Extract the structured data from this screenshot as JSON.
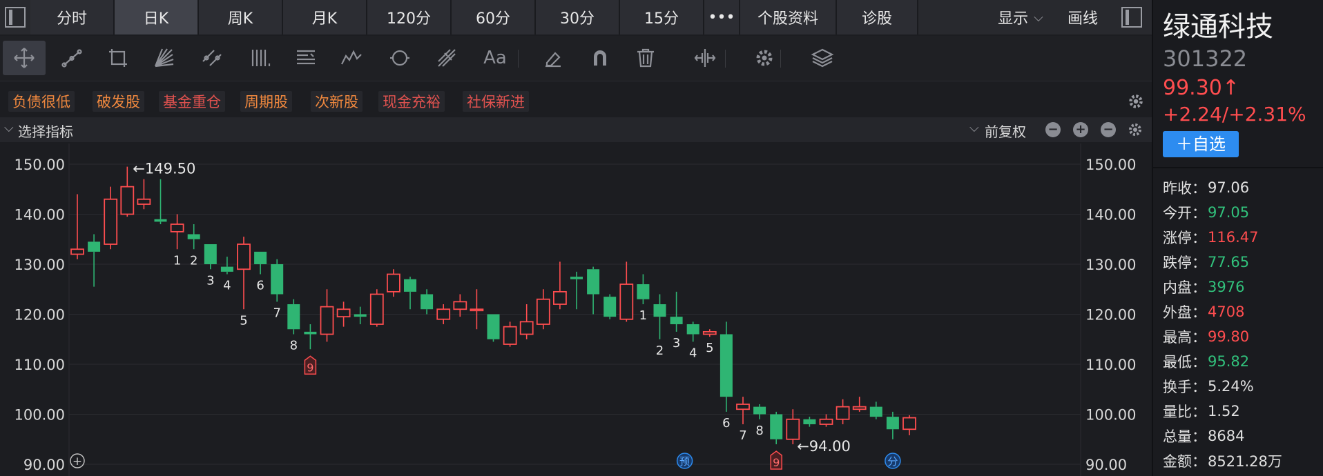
{
  "tabs": [
    {
      "label": "分时",
      "active": false
    },
    {
      "label": "日K",
      "active": true
    },
    {
      "label": "周K",
      "active": false
    },
    {
      "label": "月K",
      "active": false
    },
    {
      "label": "120分",
      "active": false
    },
    {
      "label": "60分",
      "active": false
    },
    {
      "label": "30分",
      "active": false
    },
    {
      "label": "15分",
      "active": false
    },
    {
      "label": "•••",
      "active": false
    },
    {
      "label": "个股资料",
      "active": false
    },
    {
      "label": "诊股",
      "active": false
    }
  ],
  "header_right": {
    "display_label": "显示",
    "draw_label": "画线"
  },
  "tools": [
    "move-tool-icon",
    "line-segment-icon",
    "rectangle-icon",
    "fan-icon",
    "parallel-channel-icon",
    "vertical-lines-icon",
    "gann-icon",
    "wave-icon",
    "cycle-icon",
    "fork-icon",
    "text-icon",
    "eraser-icon",
    "magnet-icon",
    "trash-icon",
    "scale-icon",
    "settings-icon",
    "layers-icon"
  ],
  "text_tool_label": "Aa",
  "tags": [
    {
      "label": "负债很低",
      "color": "#f0883e"
    },
    {
      "label": "破发股",
      "color": "#f0883e"
    },
    {
      "label": "基金重仓",
      "color": "#e0524f"
    },
    {
      "label": "周期股",
      "color": "#f0883e"
    },
    {
      "label": "次新股",
      "color": "#f0883e"
    },
    {
      "label": "现金充裕",
      "color": "#e0524f"
    },
    {
      "label": "社保新进",
      "color": "#e0524f"
    }
  ],
  "indicator_bar": {
    "select_label": "选择指标",
    "adjust_label": "前复权",
    "buttons": [
      "minus-circle",
      "plus-circle",
      "minus-circle",
      "settings"
    ]
  },
  "stock": {
    "name": "绿通科技",
    "code": "301322",
    "price": "99.30↑",
    "change": "+2.24/+2.31%",
    "add_watch": "＋自选"
  },
  "stats": [
    {
      "key": "昨收：",
      "value": "97.06",
      "color": "w"
    },
    {
      "key": "今开：",
      "value": "97.05",
      "color": "g"
    },
    {
      "key": "涨停：",
      "value": "116.47",
      "color": "r"
    },
    {
      "key": "跌停：",
      "value": "77.65",
      "color": "g"
    },
    {
      "key": "内盘：",
      "value": "3976",
      "color": "g"
    },
    {
      "key": "外盘：",
      "value": "4708",
      "color": "r"
    },
    {
      "key": "最高：",
      "value": "99.80",
      "color": "r"
    },
    {
      "key": "最低：",
      "value": "95.82",
      "color": "g"
    },
    {
      "key": "换手：",
      "value": "5.24%",
      "color": "w"
    },
    {
      "key": "量比：",
      "value": "1.52",
      "color": "w"
    },
    {
      "key": "总量：",
      "value": "8684",
      "color": "w"
    },
    {
      "key": "金额：",
      "value": "8521.28万",
      "color": "w"
    }
  ],
  "colors": {
    "up": "#ff4d4f",
    "down": "#2fb573",
    "grid": "#2b2c31",
    "axis_text": "#d8d8d8"
  },
  "chart_data": {
    "type": "candlestick",
    "ylim": [
      90,
      150
    ],
    "y_ticks": [
      "150.00",
      "140.00",
      "130.00",
      "120.00",
      "110.00",
      "100.00",
      "90.00"
    ],
    "high_label": "←149.50",
    "low_label": "←94.00",
    "candles": [
      {
        "o": 132,
        "c": 133,
        "h": 144,
        "l": 131
      },
      {
        "o": 134.5,
        "c": 132.5,
        "h": 136,
        "l": 125.5
      },
      {
        "o": 134,
        "c": 143,
        "h": 145.5,
        "l": 133
      },
      {
        "o": 140,
        "c": 145.5,
        "h": 149.5,
        "l": 139.5
      },
      {
        "o": 142,
        "c": 143,
        "h": 147,
        "l": 141
      },
      {
        "o": 139,
        "c": 138.5,
        "h": 147,
        "l": 138
      },
      {
        "o": 136.5,
        "c": 138,
        "h": 140,
        "l": 133
      },
      {
        "o": 136,
        "c": 135,
        "h": 138,
        "l": 133
      },
      {
        "o": 134,
        "c": 130,
        "h": 134,
        "l": 129
      },
      {
        "o": 129.5,
        "c": 128.5,
        "h": 131.5,
        "l": 128
      },
      {
        "o": 129,
        "c": 134,
        "h": 135.5,
        "l": 121
      },
      {
        "o": 132.5,
        "c": 130,
        "h": 132.5,
        "l": 128
      },
      {
        "o": 130,
        "c": 124,
        "h": 131,
        "l": 122.5
      },
      {
        "o": 122,
        "c": 117,
        "h": 123,
        "l": 116
      },
      {
        "o": 116.5,
        "c": 116,
        "h": 118,
        "l": 113
      },
      {
        "o": 116,
        "c": 121.5,
        "h": 125,
        "l": 114.5
      },
      {
        "o": 119.5,
        "c": 121,
        "h": 122.5,
        "l": 117.5
      },
      {
        "o": 120,
        "c": 119.5,
        "h": 121.5,
        "l": 118
      },
      {
        "o": 118,
        "c": 124,
        "h": 125,
        "l": 117.5
      },
      {
        "o": 124.5,
        "c": 128,
        "h": 129,
        "l": 123.5
      },
      {
        "o": 127,
        "c": 124.5,
        "h": 127.5,
        "l": 121
      },
      {
        "o": 124,
        "c": 121,
        "h": 125,
        "l": 120
      },
      {
        "o": 119,
        "c": 121,
        "h": 122,
        "l": 118
      },
      {
        "o": 121,
        "c": 122.5,
        "h": 124,
        "l": 119.5
      },
      {
        "o": 121,
        "c": 121,
        "h": 125,
        "l": 117
      },
      {
        "o": 120,
        "c": 115,
        "h": 120,
        "l": 114.5
      },
      {
        "o": 114,
        "c": 117.5,
        "h": 118.5,
        "l": 113.5
      },
      {
        "o": 116,
        "c": 118.5,
        "h": 122,
        "l": 115
      },
      {
        "o": 118,
        "c": 123,
        "h": 125,
        "l": 117
      },
      {
        "o": 122,
        "c": 124.5,
        "h": 130.5,
        "l": 121
      },
      {
        "o": 127.5,
        "c": 127,
        "h": 128.5,
        "l": 121
      },
      {
        "o": 129,
        "c": 124,
        "h": 129.5,
        "l": 120
      },
      {
        "o": 123.5,
        "c": 119.5,
        "h": 124,
        "l": 119
      },
      {
        "o": 119,
        "c": 126,
        "h": 130.5,
        "l": 118.5
      },
      {
        "o": 126,
        "c": 123,
        "h": 128,
        "l": 122
      },
      {
        "o": 122,
        "c": 119.5,
        "h": 124,
        "l": 115
      },
      {
        "o": 119.5,
        "c": 118,
        "h": 124.5,
        "l": 116.5
      },
      {
        "o": 118,
        "c": 116,
        "h": 118.5,
        "l": 114.5
      },
      {
        "o": 116,
        "c": 116.5,
        "h": 117,
        "l": 115.5
      },
      {
        "o": 116,
        "c": 103.5,
        "h": 118.5,
        "l": 100.5
      },
      {
        "o": 101,
        "c": 102,
        "h": 103.5,
        "l": 98
      },
      {
        "o": 101.5,
        "c": 100,
        "h": 102,
        "l": 99
      },
      {
        "o": 100,
        "c": 95,
        "h": 100.5,
        "l": 94
      },
      {
        "o": 95,
        "c": 99,
        "h": 101,
        "l": 94
      },
      {
        "o": 99,
        "c": 98,
        "h": 99.5,
        "l": 97.5
      },
      {
        "o": 98,
        "c": 99,
        "h": 100,
        "l": 97.5
      },
      {
        "o": 99,
        "c": 101.5,
        "h": 103,
        "l": 98
      },
      {
        "o": 101,
        "c": 101.5,
        "h": 103.5,
        "l": 100.5
      },
      {
        "o": 101.5,
        "c": 99.5,
        "h": 102.5,
        "l": 99
      },
      {
        "o": 99.5,
        "c": 97,
        "h": 100.5,
        "l": 95
      },
      {
        "o": 97,
        "c": 99.3,
        "h": 99.8,
        "l": 95.8
      }
    ],
    "count_labels": [
      {
        "i": 6,
        "t": "1"
      },
      {
        "i": 7,
        "t": "2"
      },
      {
        "i": 8,
        "t": "3"
      },
      {
        "i": 9,
        "t": "4"
      },
      {
        "i": 10,
        "t": "5"
      },
      {
        "i": 11,
        "t": "6"
      },
      {
        "i": 12,
        "t": "7"
      },
      {
        "i": 13,
        "t": "8"
      },
      {
        "i": 34,
        "t": "1"
      },
      {
        "i": 35,
        "t": "2"
      },
      {
        "i": 36,
        "t": "3"
      },
      {
        "i": 37,
        "t": "4"
      },
      {
        "i": 38,
        "t": "5"
      },
      {
        "i": 39,
        "t": "6"
      },
      {
        "i": 40,
        "t": "7"
      },
      {
        "i": 41,
        "t": "8"
      }
    ],
    "nine_markers": [
      {
        "i": 14,
        "t": "9"
      },
      {
        "i": 42,
        "t": "9"
      }
    ],
    "event_markers": [
      {
        "i": 36,
        "t": "预"
      },
      {
        "i": 49,
        "t": "分"
      }
    ],
    "plus_marker": "+"
  }
}
